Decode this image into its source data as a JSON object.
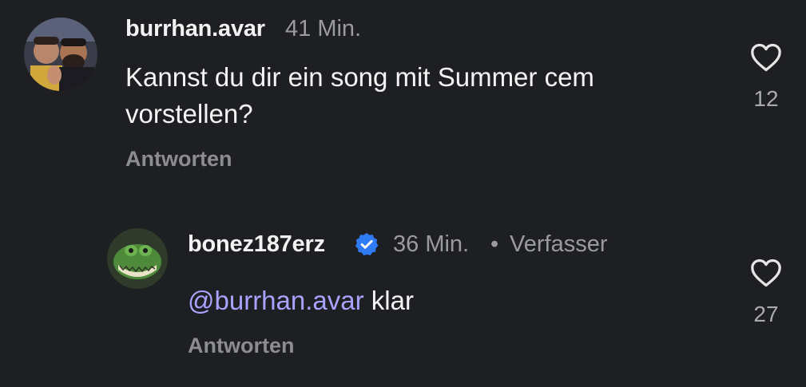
{
  "comments": [
    {
      "username": "burrhan.avar",
      "time": "41 Min.",
      "text_line1": "Kannst du dir ein song mit Summer cem",
      "text_line2": "vorstellen?",
      "reply_label": "Antworten",
      "likes": "12"
    },
    {
      "username": "bonez187erz",
      "verified": true,
      "time": "36 Min.",
      "separator": "•",
      "author_label": "Verfasser",
      "mention": "@burrhan.avar",
      "text": "klar",
      "reply_label": "Antworten",
      "likes": "27"
    }
  ],
  "colors": {
    "background": "#1e1f22",
    "text": "#f2f2f2",
    "meta": "#9a9ba0",
    "mention": "#a7a3ff",
    "verified": "#2f7bf5"
  },
  "icons": {
    "like": "heart-outline-icon",
    "verified": "verified-badge-icon"
  }
}
